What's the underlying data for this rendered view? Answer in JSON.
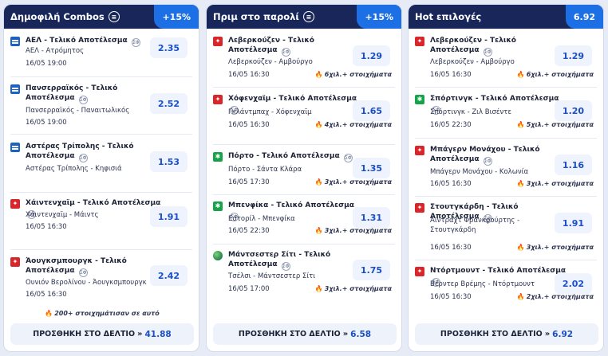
{
  "panels": [
    {
      "title": "Δημοφιλή Combos",
      "badge": "+15%",
      "bets": [
        {
          "title": "ΑΕΛ - Τελικό Αποτέλεσμα",
          "match": "ΑΕΛ - Ατρόμητος",
          "time": "16/05 19:00",
          "odds": "2.35",
          "icon": "calendar-icon"
        },
        {
          "title": "Πανσερραϊκός - Τελικό Αποτέλεσμα",
          "match": "Πανσερραϊκός - Παναιτωλικός",
          "time": "16/05 19:00",
          "odds": "2.52",
          "icon": "calendar-icon"
        },
        {
          "title": "Αστέρας Τρίπολης - Τελικό Αποτέλεσμα",
          "match": "Αστέρας Τρίπολης - Κηφισιά",
          "time": "16/05 19:00",
          "odds": "1.53",
          "icon": "calendar-icon"
        },
        {
          "title": "Χάιντενχαϊμ - Τελικό Αποτέλεσμα",
          "match": "Χάιντενχαϊμ - Μάιντς",
          "time": "16/05 16:30",
          "odds": "1.91",
          "icon": "bundesliga-icon"
        },
        {
          "title": "Άουγκσμπουργκ - Τελικό Αποτέλεσμα",
          "match": "Ουνιόν Βερολίνου - Άουγκσμπουργκ",
          "time": "16/05 16:30",
          "odds": "2.42",
          "icon": "bundesliga-icon"
        }
      ],
      "footnote": "200+ στοιχημάτισαν σε αυτό",
      "add_label": "ΠΡΟΣΘΗΚΗ ΣΤΟ ΔΕΛΤΙΟ",
      "total": "41.88"
    },
    {
      "title": "Πριμ στο παρολί",
      "badge": "+15%",
      "bets": [
        {
          "title": "Λεβερκούζεν - Τελικό Αποτέλεσμα",
          "match": "Λεβερκούζεν - Αμβούργο",
          "time": "16/05 16:30",
          "odds": "1.29",
          "plus": "6χιλ.+ στοιχήματα",
          "icon": "bundesliga-icon"
        },
        {
          "title": "Χόφενχαϊμ - Τελικό Αποτέλεσμα",
          "match": "Γκλάντμπαχ - Χόφενχαϊμ",
          "time": "16/05 16:30",
          "odds": "1.65",
          "plus": "4χιλ.+ στοιχήματα",
          "icon": "bundesliga-icon"
        },
        {
          "title": "Πόρτο - Τελικό Αποτέλεσμα",
          "match": "Πόρτο - Σάντα Κλάρα",
          "time": "16/05 17:30",
          "odds": "1.35",
          "plus": "3χιλ.+ στοιχήματα",
          "icon": "liga-portugal-icon"
        },
        {
          "title": "Μπενφίκα - Τελικό Αποτέλεσμα",
          "match": "Εστορίλ - Μπενφίκα",
          "time": "16/05 22:30",
          "odds": "1.31",
          "plus": "3χιλ.+ στοιχήματα",
          "icon": "liga-portugal-icon"
        },
        {
          "title": "Μάντσεστερ Σίτι - Τελικό Αποτέλεσμα",
          "match": "Τσέλσι - Μάντσεστερ Σίτι",
          "time": "16/05 17:00",
          "odds": "1.75",
          "plus": "3χιλ.+ στοιχήματα",
          "icon": "globe-icon"
        }
      ],
      "add_label": "ΠΡΟΣΘΗΚΗ ΣΤΟ ΔΕΛΤΙΟ",
      "total": "6.58"
    },
    {
      "title": "Hot επιλογές",
      "badge": "6.92",
      "bets": [
        {
          "title": "Λεβερκούζεν - Τελικό Αποτέλεσμα",
          "match": "Λεβερκούζεν - Αμβούργο",
          "time": "16/05 16:30",
          "odds": "1.29",
          "plus": "6χιλ.+ στοιχήματα",
          "icon": "bundesliga-icon"
        },
        {
          "title": "Σπόρτινγκ - Τελικό Αποτέλεσμα",
          "match": "Σπόρτινγκ - Ζιλ Βισέντε",
          "time": "16/05 22:30",
          "odds": "1.20",
          "plus": "5χιλ.+ στοιχήματα",
          "icon": "liga-portugal-icon"
        },
        {
          "title": "Μπάγερν Μονάχου - Τελικό Αποτέλεσμα",
          "match": "Μπάγερν Μονάχου - Κολωνία",
          "time": "16/05 16:30",
          "odds": "1.16",
          "plus": "3χιλ.+ στοιχήματα",
          "icon": "bundesliga-icon"
        },
        {
          "title": "Στουτγκάρδη - Τελικό Αποτέλεσμα",
          "match": "Άιντραχτ Φρανκφούρτης - Στουτγκάρδη",
          "time": "16/05 16:30",
          "odds": "1.91",
          "plus": "3χιλ.+ στοιχήματα",
          "icon": "bundesliga-icon"
        },
        {
          "title": "Ντόρτμουντ - Τελικό Αποτέλεσμα",
          "match": "Βέρντερ Βρέμης - Ντόρτμουντ",
          "time": "16/05 16:30",
          "odds": "2.02",
          "plus": "2χιλ.+ στοιχήματα",
          "icon": "bundesliga-icon"
        }
      ],
      "add_label": "ΠΡΟΣΘΗΚΗ ΣΤΟ ΔΕΛΤΙΟ",
      "total": "6.92"
    }
  ]
}
